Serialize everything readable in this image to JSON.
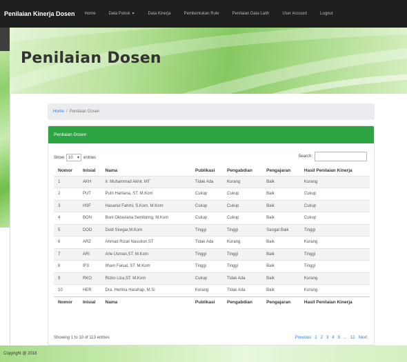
{
  "nav": {
    "brand": "Penilaian Kinerja Dosen",
    "items": [
      {
        "label": "Home",
        "dropdown": false
      },
      {
        "label": "Data Pokok",
        "dropdown": true
      },
      {
        "label": "Data Kinerja",
        "dropdown": false
      },
      {
        "label": "Pembentukan Rule",
        "dropdown": false
      },
      {
        "label": "Penilaian Data Latih",
        "dropdown": false
      },
      {
        "label": "User Account",
        "dropdown": false
      },
      {
        "label": "Logout",
        "dropdown": false
      }
    ]
  },
  "hero": {
    "title": "Penilaian Dosen"
  },
  "breadcrumb": {
    "home": "Home",
    "separator": "/",
    "current": "Penilaian Dosen"
  },
  "card": {
    "title": "Penilaian Dosen"
  },
  "table_controls": {
    "show_label": "Show",
    "show_value": "10",
    "entries_label": "entries",
    "search_label": "Search:"
  },
  "columns": [
    "Nomor",
    "Inisial",
    "Nama",
    "Publikasi",
    "Pengabdian",
    "Pengajaran",
    "Hasil Penilaian Kinerja"
  ],
  "rows": [
    [
      "1",
      "AKH",
      "Ir. Muhammad Akhir, MT",
      "Tidak Ada",
      "Kurang",
      "Baik",
      "Kurang"
    ],
    [
      "2",
      "PUT",
      "Putri Harliana, ST. M.Kom",
      "Cukup",
      "Cukup",
      "Baik",
      "Cukup"
    ],
    [
      "3",
      "HSF",
      "Hasanul Fahmi, S.Kom. M.Kom",
      "Cukup",
      "Cukup",
      "Baik",
      "Cukup"
    ],
    [
      "4",
      "BON",
      "Boni Oktaviana Sembiring, M.Kom",
      "Cukup",
      "Cukup",
      "Baik",
      "Cukup"
    ],
    [
      "5",
      "DOD",
      "Dodi Siregar,M.Kom",
      "Tinggi",
      "Tinggi",
      "Sangat Baik",
      "Tinggi"
    ],
    [
      "6",
      "ARZ",
      "Ahmad Rizali Nasution,ST",
      "Tidak Ada",
      "Kurang",
      "Baik",
      "Kurang"
    ],
    [
      "7",
      "ARI",
      "Arie Usman,ST. M.Kom",
      "Tinggi",
      "Tinggi",
      "Baik",
      "Tinggi"
    ],
    [
      "8",
      "IFS",
      "Ilham Faisal, ST. M.Kom",
      "Tinggi",
      "Tinggi",
      "Baik",
      "Tinggi"
    ],
    [
      "9",
      "RKO",
      "Rizko Liza,ST. M.Kom",
      "Cukup",
      "Tidak Ada",
      "Baik",
      "Kurang"
    ],
    [
      "10",
      "HER",
      "Dra. Herlina Harahap, M.Si",
      "Kurang",
      "Tidak Ada",
      "Baik",
      "Kurang"
    ]
  ],
  "table_footer": {
    "info": "Showing 1 to 10 of 113 entries",
    "pagination": [
      "Previous",
      "1",
      "2",
      "3",
      "4",
      "5",
      "...",
      "12",
      "Next"
    ]
  },
  "footer": {
    "copyright": "Copyright @ 2018"
  },
  "colors": {
    "navbar": "#1f1f1f",
    "card_header": "#2ea543",
    "link": "#2f7fd0"
  }
}
